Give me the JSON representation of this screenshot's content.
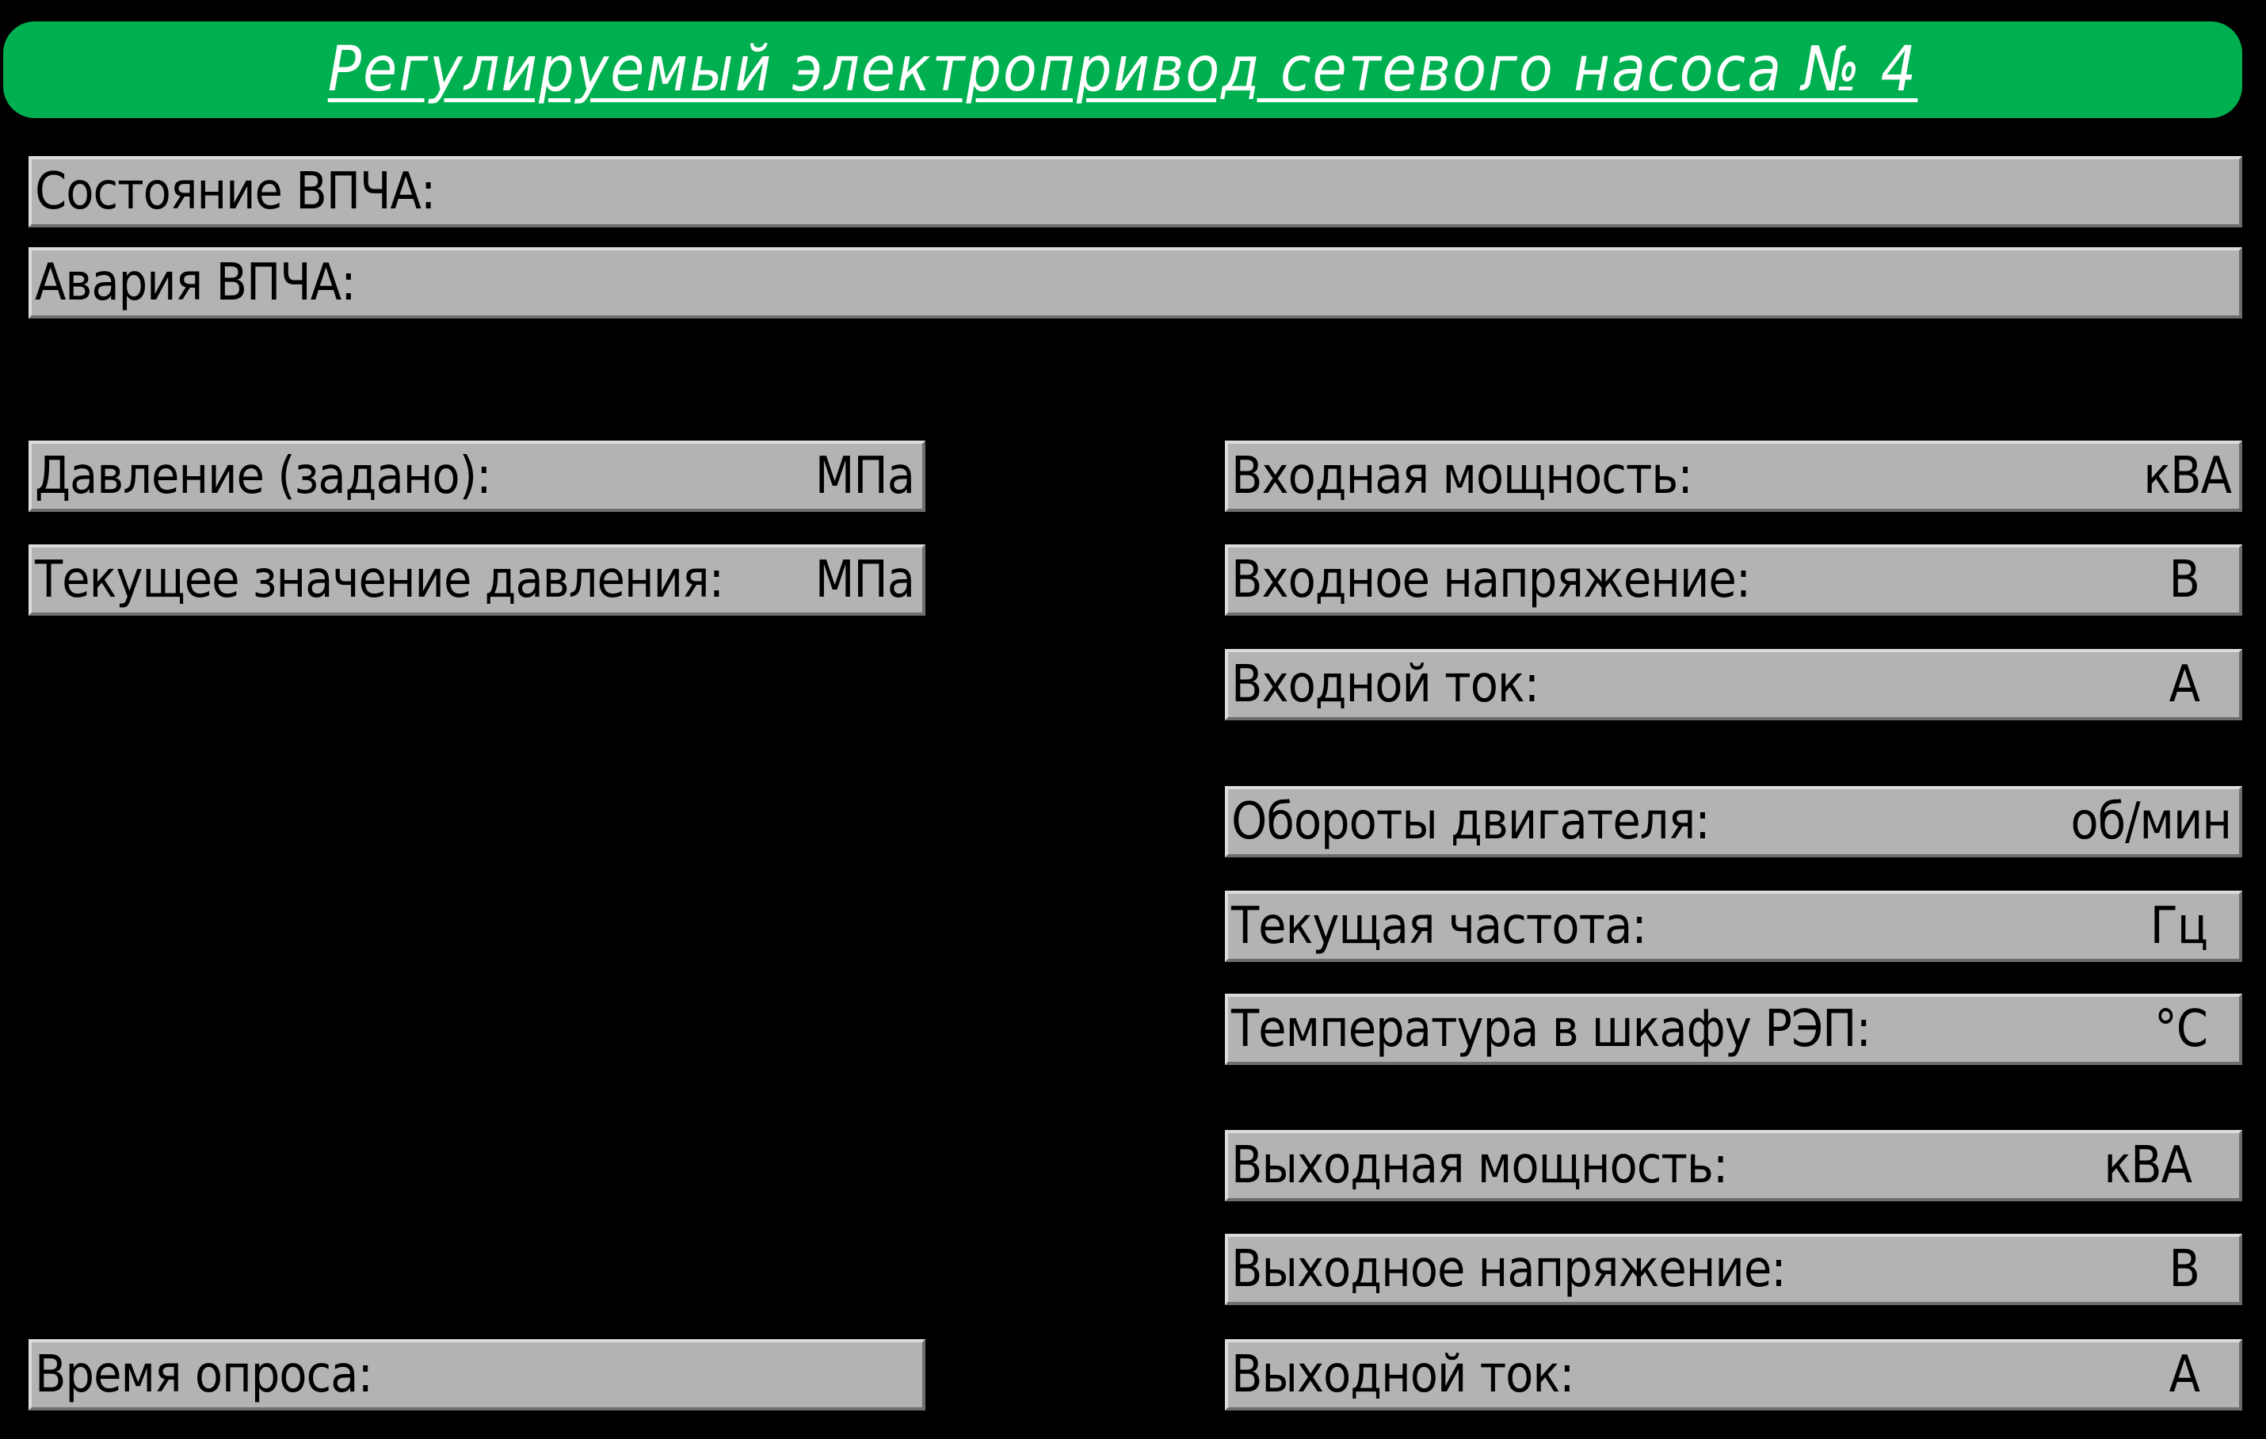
{
  "header": {
    "title": "Регулируемый электропривод сетевого насоса № 4"
  },
  "status": {
    "state_label": "Состояние ВПЧА:",
    "alarm_label": "Авария ВПЧА:"
  },
  "left_panel": {
    "pressure_setpoint": {
      "label": "Давление (задано):",
      "unit": "МПа"
    },
    "pressure_current": {
      "label": "Текущее значение давления:",
      "unit": "МПа"
    },
    "poll_time": {
      "label": "Время опроса:"
    }
  },
  "right_panel": {
    "input_power": {
      "label": "Входная мощность:",
      "unit": "кВА"
    },
    "input_voltage": {
      "label": "Входное напряжение:",
      "unit": "В"
    },
    "input_current": {
      "label": "Входной ток:",
      "unit": "А"
    },
    "motor_rpm": {
      "label": "Обороты двигателя:",
      "unit": "об/мин"
    },
    "frequency": {
      "label": "Текущая частота:",
      "unit": "Гц"
    },
    "cabinet_temp": {
      "label": "Температура в шкафу РЭП:",
      "unit": "°С"
    },
    "output_power": {
      "label": "Выходная мощность:",
      "unit": "кВА"
    },
    "output_voltage": {
      "label": "Выходное напряжение:",
      "unit": "В"
    },
    "output_current": {
      "label": "Выходной ток:",
      "unit": "А"
    }
  },
  "colors": {
    "background": "#000000",
    "title_bar": "#00b050",
    "title_text": "#ffffff",
    "field_bg": "#b3b3b3",
    "field_text": "#000000"
  }
}
